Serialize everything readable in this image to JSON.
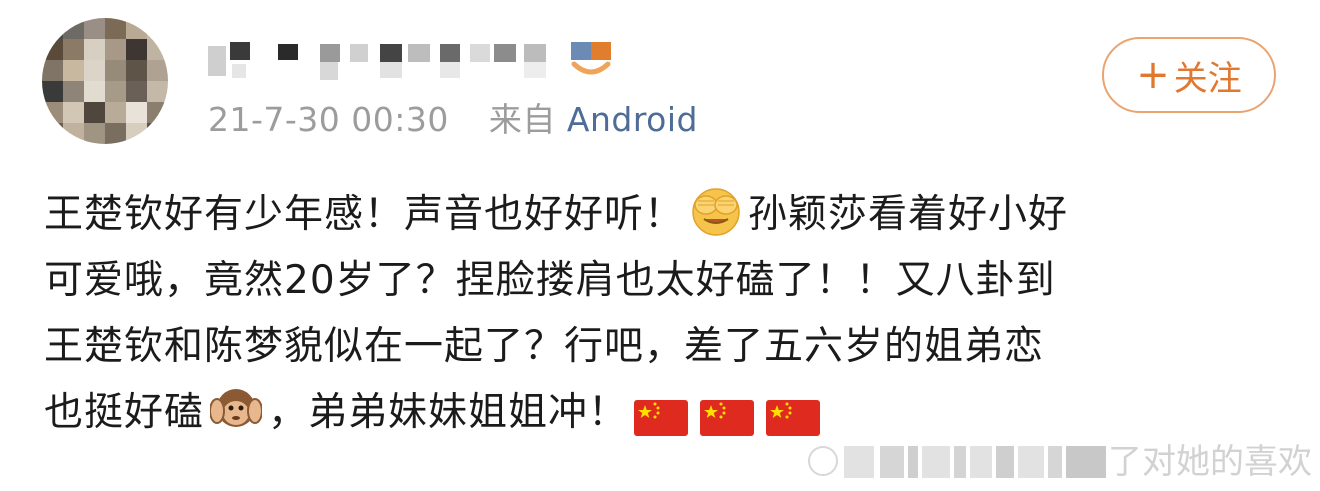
{
  "post": {
    "timestamp": "21-7-30 00:30",
    "source_prefix": "来自",
    "source_name": "Android",
    "follow_plus": "+",
    "follow_label": "关注",
    "content_lines": [
      {
        "seg1": "王楚钦好有少年感！声音也好好听！",
        "seg2": "孙颖莎看着好小好"
      },
      {
        "seg1": "可爱哦，竟然20岁了？捏脸搂肩也太好磕了！！又八卦到"
      },
      {
        "seg1": "王楚钦和陈梦貌似在一起了？行吧，差了五六岁的姐弟恋"
      },
      {
        "seg1": "也挺好磕",
        "seg2": "，弟弟妹妹姐姐冲！"
      }
    ],
    "emojis": {
      "line1": "face-covering-eyes-emoji",
      "line4_monkey": "hear-no-evil-monkey-emoji",
      "flags": [
        "china-flag-emoji",
        "china-flag-emoji",
        "china-flag-emoji"
      ]
    },
    "watermark_suffix": "了对她的喜欢"
  },
  "colors": {
    "follow_accent": "#e0782f",
    "follow_border": "#e9a470",
    "meta_gray": "#9c9c9c",
    "source_link": "#4e6c97",
    "body_text": "#1b1b1b"
  }
}
